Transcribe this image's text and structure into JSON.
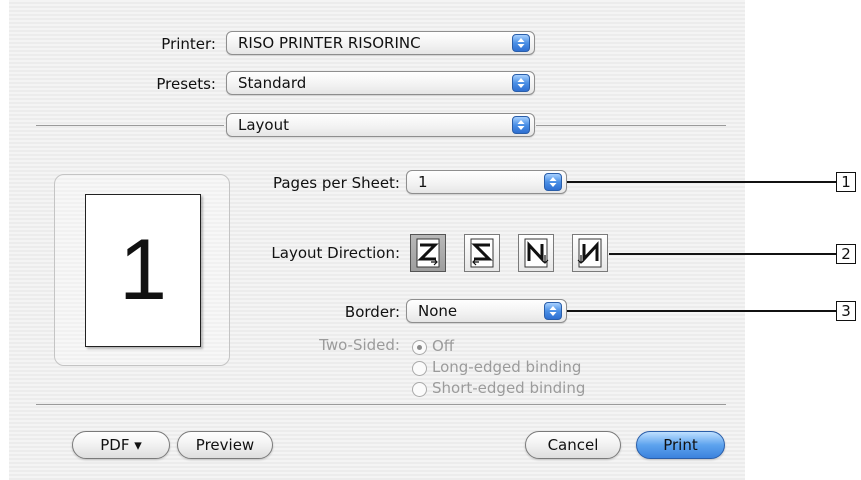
{
  "printer": {
    "label": "Printer:",
    "value": "RISO PRINTER RISORINC"
  },
  "presets": {
    "label": "Presets:",
    "value": "Standard"
  },
  "panel": {
    "value": "Layout"
  },
  "preview": {
    "page_number": "1"
  },
  "pages_per_sheet": {
    "label": "Pages per Sheet:",
    "value": "1"
  },
  "layout_direction": {
    "label": "Layout Direction:",
    "options": [
      "left-to-right-top-down",
      "right-to-left-top-down",
      "top-down-left-to-right",
      "top-down-right-to-left"
    ],
    "selected_index": 0
  },
  "border": {
    "label": "Border:",
    "value": "None"
  },
  "two_sided": {
    "label": "Two-Sided:",
    "options": [
      {
        "label": "Off",
        "selected": true
      },
      {
        "label": "Long-edged binding",
        "selected": false
      },
      {
        "label": "Short-edged binding",
        "selected": false
      }
    ],
    "disabled": true
  },
  "buttons": {
    "pdf": "PDF ▾",
    "preview": "Preview",
    "cancel": "Cancel",
    "print": "Print"
  },
  "callouts": [
    "1",
    "2",
    "3"
  ],
  "colors": {
    "accent": "#3b82dd",
    "disabled_text": "#9b9b9b"
  }
}
